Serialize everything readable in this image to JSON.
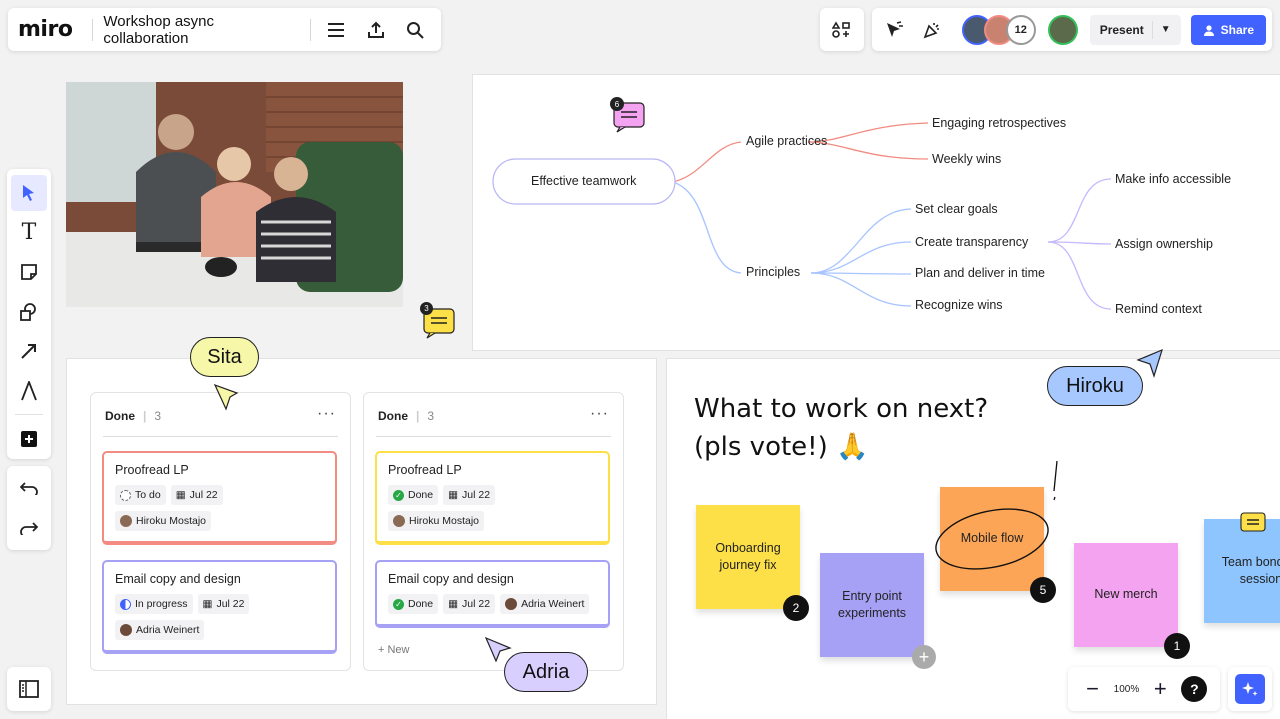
{
  "app": {
    "logo": "miro",
    "board_title": "Workshop async collaboration"
  },
  "topbar": {
    "collaborator_count": "12",
    "present_label": "Present",
    "share_label": "Share"
  },
  "mind_map": {
    "comment_count": "6",
    "root": "Effective teamwork",
    "branches": [
      {
        "label": "Agile practices",
        "children": [
          "Engaging retrospectives",
          "Weekly wins"
        ]
      },
      {
        "label": "Principles",
        "children": [
          "Set clear goals",
          "Create transparency",
          "Plan and deliver in time",
          "Recognize wins"
        ]
      }
    ],
    "transparency_children": [
      "Make info accessible",
      "Assign ownership",
      "Remind context"
    ]
  },
  "photo_comment_count": "3",
  "kanban": {
    "columns": [
      {
        "title": "Done",
        "count": "3",
        "cards": [
          {
            "title": "Proofread LP",
            "status": "To do",
            "date": "Jul 22",
            "assignee": "Hiroku Mostajo"
          },
          {
            "title": "Email copy and design",
            "status": "In progress",
            "date": "Jul 22",
            "assignee": "Adria Weinert"
          }
        ]
      },
      {
        "title": "Done",
        "count": "3",
        "cards": [
          {
            "title": "Proofread LP",
            "status": "Done",
            "date": "Jul 22",
            "assignee": "Hiroku Mostajo"
          },
          {
            "title": "Email copy and design",
            "status": "Done",
            "date": "Jul 22",
            "assignee": "Adria Weinert"
          }
        ],
        "new_label": "New"
      }
    ]
  },
  "cursors": {
    "sita": "Sita",
    "adria": "Adria",
    "hiroku": "Hiroku"
  },
  "vote": {
    "title_line1": "What to work on next?",
    "title_line2": "(pls vote!) 🙏",
    "stickies": [
      {
        "text": "Onboarding journey fix",
        "votes": "2",
        "color": "#fde047"
      },
      {
        "text": "Entry point experiments",
        "votes": "",
        "color": "#a7a1f5"
      },
      {
        "text": "Mobile flow",
        "votes": "5",
        "color": "#fda556"
      },
      {
        "text": "New merch",
        "votes": "1",
        "color": "#f4a3f0"
      },
      {
        "text": "Team bonding session",
        "votes": "",
        "color": "#8ec5ff"
      }
    ]
  },
  "zoom": {
    "level": "100%",
    "help": "?"
  },
  "colors": {
    "accent": "#4262ff",
    "agile_branch": "#f28b82",
    "principles_branch": "#a7c4ff",
    "transparency_branch": "#c7b8ff"
  }
}
